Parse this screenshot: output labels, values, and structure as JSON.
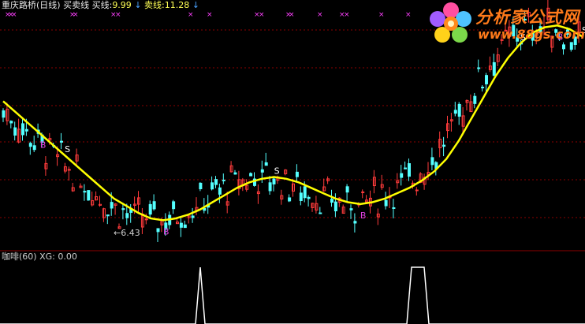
{
  "main_panel": {
    "stock_name": "重庆路桥(日线)",
    "indicator_name": "买卖线",
    "buy_label": "买线:",
    "buy_value": "9.99",
    "sell_label": "卖线:",
    "sell_value": "11.28",
    "arrow": "↓",
    "low_marker": "←6.43",
    "signal_letters": {
      "buy": "B",
      "sell": "S"
    }
  },
  "sub_panel": {
    "indicator_name": "咖啡(60)",
    "label": "XG:",
    "value": "0.00"
  },
  "logo": {
    "title": "分析家公式网",
    "url": "www.88gs.com"
  },
  "colors": {
    "background": "#000000",
    "grid": "#8b0000",
    "up_candle": "#ff3b3b",
    "down_candle": "#54ffff",
    "ma_line": "#ffff00",
    "signal_line": "#ffffff",
    "buy_marker": "#e040e0",
    "sell_marker": "#ffffff",
    "top_marks": "#ff40ff",
    "logo": "#ff7a1a"
  },
  "chart_data": {
    "type": "candlestick",
    "title": "重庆路桥(日线)",
    "y_range_approx": [
      6.0,
      12.6
    ],
    "visible_low": 6.43,
    "ma_line_levels": [
      10.1,
      9.8,
      9.5,
      9.2,
      8.9,
      8.6,
      8.3,
      8.0,
      7.7,
      7.4,
      7.2,
      7.0,
      6.85,
      6.8,
      6.85,
      6.95,
      7.1,
      7.3,
      7.5,
      7.7,
      7.85,
      7.95,
      8.0,
      7.95,
      7.85,
      7.7,
      7.55,
      7.4,
      7.3,
      7.25,
      7.3,
      7.4,
      7.55,
      7.7,
      7.9,
      8.15,
      8.5,
      9.0,
      9.6,
      10.2,
      10.8,
      11.3,
      11.7,
      12.0,
      12.15,
      12.2,
      12.1,
      11.9
    ],
    "signals": [
      {
        "type": "B",
        "index": 3
      },
      {
        "type": "S",
        "index": 5
      },
      {
        "type": "B",
        "index": 13
      },
      {
        "type": "S",
        "index": 22
      },
      {
        "type": "B",
        "index": 29
      },
      {
        "type": "S",
        "index": 42
      },
      {
        "type": "B",
        "index": 45
      },
      {
        "type": "S",
        "index": 47
      }
    ],
    "sub_signal_pulses": [
      {
        "label": "XG",
        "index": 17
      },
      {
        "label": "XG",
        "index": 37
      }
    ]
  }
}
